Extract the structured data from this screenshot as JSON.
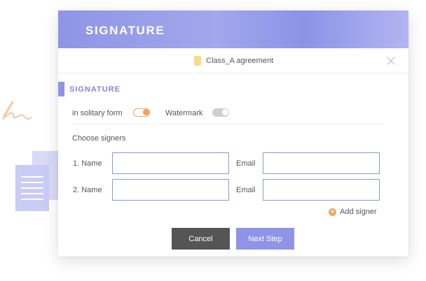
{
  "dialog": {
    "banner_title": "SIGNATURE",
    "file_name": "Class_A agreement",
    "section_title": "SIGNATURE",
    "options": {
      "solitary_label": "in solitary form",
      "solitary_on": true,
      "watermark_label": "Watermark",
      "watermark_on": false
    },
    "signers_label": "Choose signers",
    "signers": [
      {
        "name_label": "1. Name",
        "email_label": "Email",
        "name_value": "",
        "email_value": ""
      },
      {
        "name_label": "2. Name",
        "email_label": "Email",
        "name_value": "",
        "email_value": ""
      }
    ],
    "add_signer_label": "Add signer",
    "add_signer_icon": "+",
    "buttons": {
      "cancel": "Cancel",
      "next": "Next Step"
    }
  },
  "colors": {
    "accent": "#8f94e6",
    "toggle_on": "#f0a05a",
    "cancel_button": "#555555",
    "file_icon": "#f5dd86"
  },
  "icons": {
    "file": "document-icon",
    "close": "close-icon",
    "add": "plus-circle-icon",
    "pen": "signature-pen-icon",
    "docs": "documents-icon"
  }
}
